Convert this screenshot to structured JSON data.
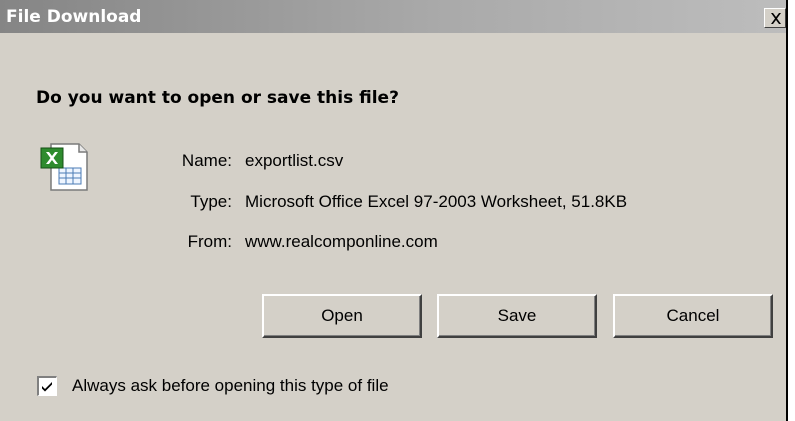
{
  "window": {
    "title": "File Download",
    "close_glyph": "X"
  },
  "dialog": {
    "question": "Do you want to open or save this file?",
    "file_icon": "excel-file-icon",
    "fields": {
      "name_label": "Name:",
      "name_value": "exportlist.csv",
      "type_label": "Type:",
      "type_value": "Microsoft Office Excel 97-2003 Worksheet, 51.8KB",
      "from_label": "From:",
      "from_value": "www.realcomponline.com"
    },
    "buttons": {
      "open_label": "Open",
      "save_label": "Save",
      "cancel_label": "Cancel"
    },
    "checkbox": {
      "checked": true,
      "label": "Always ask before opening this type of file"
    }
  },
  "colors": {
    "dialog_background": "#d4d0c8",
    "titlebar_start": "#858585",
    "titlebar_end": "#bdbdbd",
    "excel_green": "#1f7a1f"
  }
}
